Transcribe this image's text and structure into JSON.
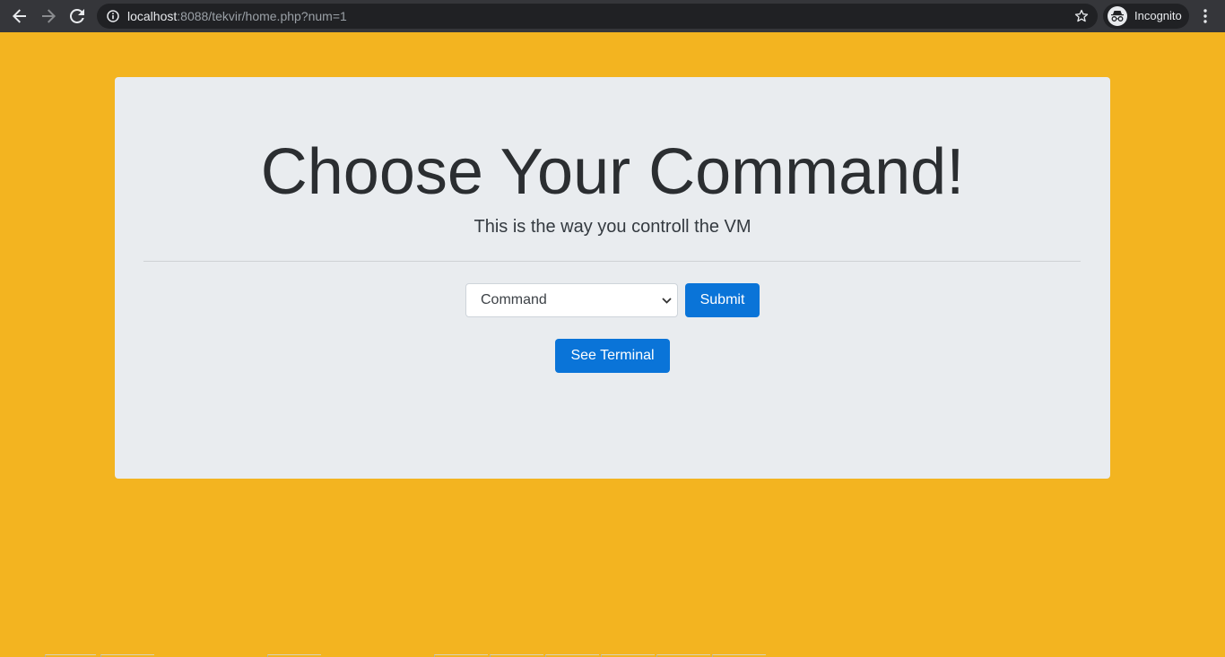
{
  "browser": {
    "url_host": "localhost",
    "url_path": ":8088/tekvir/home.php?num=1",
    "profile_label": "Incognito",
    "icons": {
      "back": "back-arrow-icon",
      "forward": "forward-arrow-icon",
      "reload": "reload-icon",
      "site_info": "info-icon",
      "bookmark": "star-icon",
      "profile": "incognito-icon",
      "menu": "kebab-menu-icon"
    }
  },
  "page": {
    "title": "Choose Your Command!",
    "subtitle": "This is the way you controll the VM",
    "command_select": {
      "selected": "Command"
    },
    "submit_label": "Submit",
    "terminal_label": "See Terminal"
  },
  "colors": {
    "page_background": "#f3b420",
    "card_background": "#e9ecef",
    "primary": "#0a74d8"
  }
}
